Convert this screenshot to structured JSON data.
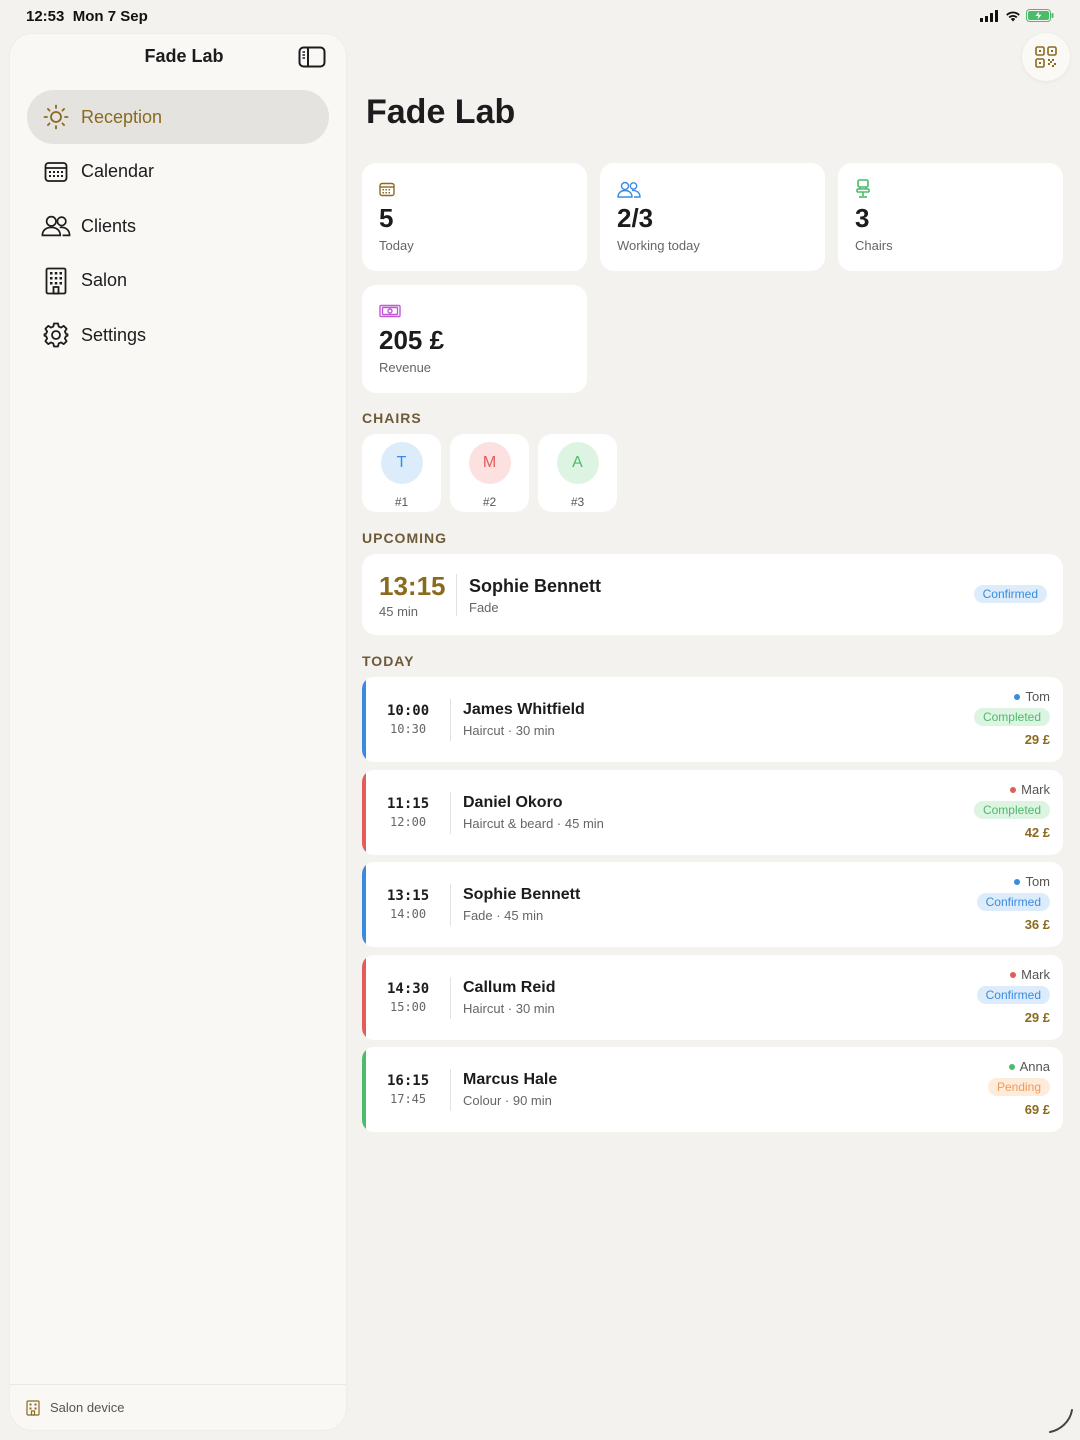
{
  "status_bar": {
    "time": "12:53",
    "date": "Mon 7 Sep"
  },
  "sidebar": {
    "title": "Fade Lab",
    "items": [
      {
        "label": "Reception",
        "icon": "sun-icon",
        "active": true
      },
      {
        "label": "Calendar",
        "icon": "calendar-icon",
        "active": false
      },
      {
        "label": "Clients",
        "icon": "people-icon",
        "active": false
      },
      {
        "label": "Salon",
        "icon": "building-icon",
        "active": false
      },
      {
        "label": "Settings",
        "icon": "gear-icon",
        "active": false
      }
    ],
    "footer": "Salon device"
  },
  "main": {
    "title": "Fade Lab",
    "stats": [
      {
        "value": "5",
        "label": "Today",
        "icon": "calendar-icon",
        "color": "#8a6a1e"
      },
      {
        "value": "2/3",
        "label": "Working today",
        "icon": "people-icon",
        "color": "#3a8be0"
      },
      {
        "value": "3",
        "label": "Chairs",
        "icon": "chair-icon",
        "color": "#4cbb6a"
      },
      {
        "value": "205 £",
        "label": "Revenue",
        "icon": "banknote-icon",
        "color": "#c05ad8"
      }
    ],
    "chairs_label": "CHAIRS",
    "chairs": [
      {
        "initial": "T",
        "number": "#1",
        "bg": "#dcecfb",
        "fg": "#3a8be0"
      },
      {
        "initial": "M",
        "number": "#2",
        "bg": "#fde0e0",
        "fg": "#e45b5b"
      },
      {
        "initial": "A",
        "number": "#3",
        "bg": "#ddf4e3",
        "fg": "#4cbb6a"
      }
    ],
    "upcoming_label": "UPCOMING",
    "upcoming": {
      "time": "13:15",
      "duration": "45 min",
      "name": "Sophie Bennett",
      "service": "Fade",
      "status": "Confirmed"
    },
    "today_label": "TODAY",
    "appointments": [
      {
        "start": "10:00",
        "end": "10:30",
        "name": "James Whitfield",
        "service": "Haircut · 30 min",
        "barber": "Tom",
        "barber_color": "#3a8be0",
        "status": "Completed",
        "status_kind": "completed",
        "price": "29 £"
      },
      {
        "start": "11:15",
        "end": "12:00",
        "name": "Daniel Okoro",
        "service": "Haircut & beard · 45 min",
        "barber": "Mark",
        "barber_color": "#e45b5b",
        "status": "Completed",
        "status_kind": "completed",
        "price": "42 £"
      },
      {
        "start": "13:15",
        "end": "14:00",
        "name": "Sophie Bennett",
        "service": "Fade · 45 min",
        "barber": "Tom",
        "barber_color": "#3a8be0",
        "status": "Confirmed",
        "status_kind": "confirmed",
        "price": "36 £"
      },
      {
        "start": "14:30",
        "end": "15:00",
        "name": "Callum Reid",
        "service": "Haircut · 30 min",
        "barber": "Mark",
        "barber_color": "#e45b5b",
        "status": "Confirmed",
        "status_kind": "confirmed",
        "price": "29 £"
      },
      {
        "start": "16:15",
        "end": "17:45",
        "name": "Marcus Hale",
        "service": "Colour · 90 min",
        "barber": "Anna",
        "barber_color": "#4cbb6a",
        "status": "Pending",
        "status_kind": "pending",
        "price": "69 £"
      }
    ]
  }
}
